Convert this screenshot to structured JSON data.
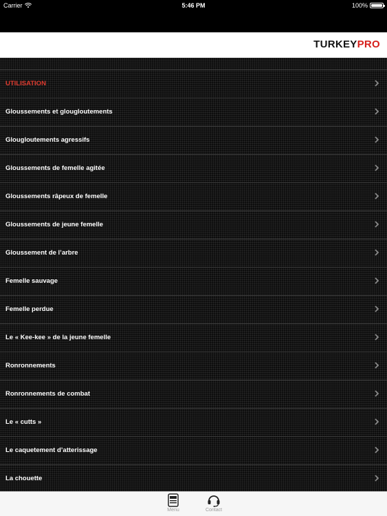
{
  "statusbar": {
    "carrier": "Carrier",
    "time": "5:46 PM",
    "battery": "100%"
  },
  "header": {
    "brand_part1": "TURKEY",
    "brand_part2": "PRO"
  },
  "list": {
    "items": [
      {
        "label": "UTILISATION"
      },
      {
        "label": "Gloussements et glougloutements"
      },
      {
        "label": "Glougloutements agressifs"
      },
      {
        "label": "Gloussements de femelle agitée"
      },
      {
        "label": "Gloussements râpeux de femelle"
      },
      {
        "label": "Gloussements de jeune femelle"
      },
      {
        "label": "Gloussement de l’arbre"
      },
      {
        "label": "Femelle sauvage"
      },
      {
        "label": "Femelle perdue"
      },
      {
        "label": "Le « Kee-kee » de la jeune femelle"
      },
      {
        "label": "Ronronnements"
      },
      {
        "label": "Ronronnements de combat"
      },
      {
        "label": "Le « cutts »"
      },
      {
        "label": "Le caquetement d’atterissage"
      },
      {
        "label": "La chouette"
      }
    ]
  },
  "tabbar": {
    "menu_label": "Menu",
    "contact_label": "Contact"
  },
  "colors": {
    "accent_red": "#d6201c",
    "first_item_red": "#e03b2f"
  }
}
